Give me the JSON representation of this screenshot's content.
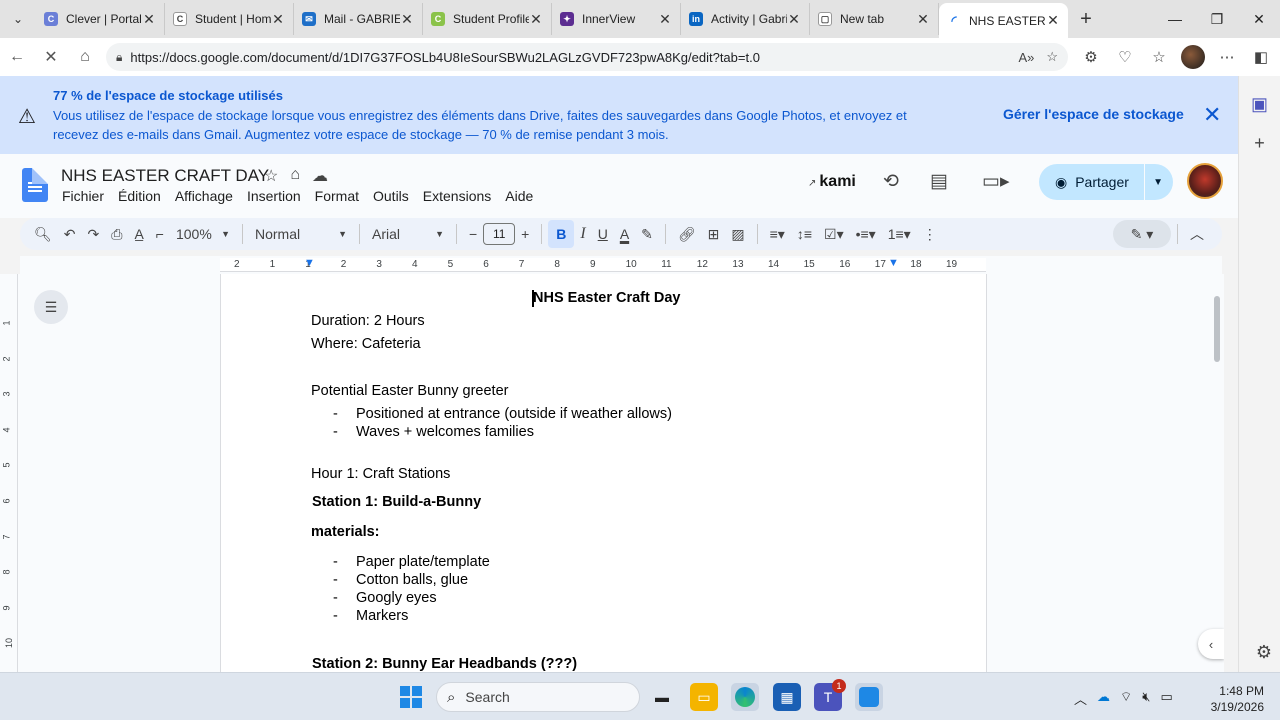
{
  "browser": {
    "tabs": [
      {
        "title": "Clever | Portal",
        "color": "#6b7fd7",
        "glyph": "C"
      },
      {
        "title": "Student | Home",
        "color": "#ffffff",
        "glyph": "C"
      },
      {
        "title": "Mail - GABRIEL",
        "color": "#1e6fc8",
        "glyph": "✉"
      },
      {
        "title": "Student Profile",
        "color": "#8bc34a",
        "glyph": "C"
      },
      {
        "title": "InnerView",
        "color": "#5c2d91",
        "glyph": "✦"
      },
      {
        "title": "Activity | Gabrie",
        "color": "#0a66c2",
        "glyph": "in"
      },
      {
        "title": "New tab",
        "color": "#ffffff",
        "glyph": "▢"
      },
      {
        "title": "NHS EASTER C",
        "color": "#1a73e8",
        "glyph": "◜"
      }
    ],
    "url": "https://docs.google.com/document/d/1DI7G37FOSLb4U8IeSourSBWu2LAGLzGVDF723pwA8Kg/edit?tab=t.0"
  },
  "banner": {
    "title": "77 % de l'espace de stockage utilisés",
    "body": "Vous utilisez de l'espace de stockage lorsque vous enregistrez des éléments dans Drive, faites des sauvegardes dans Google Photos, et envoyez et recevez des e-mails dans Gmail. Augmentez votre espace de stockage — 70 % de remise pendant 3 mois.",
    "action": "Gérer l'espace de stockage"
  },
  "doc": {
    "title": "NHS EASTER CRAFT DAY",
    "menus": [
      "Fichier",
      "Édition",
      "Affichage",
      "Insertion",
      "Format",
      "Outils",
      "Extensions",
      "Aide"
    ],
    "kami": "kami",
    "share_label": "Partager"
  },
  "toolbar": {
    "zoom": "100%",
    "style": "Normal",
    "font": "Arial",
    "font_size": "11"
  },
  "ruler": [
    "2",
    "1",
    "1",
    "2",
    "3",
    "4",
    "5",
    "6",
    "7",
    "8",
    "9",
    "10",
    "11",
    "12",
    "13",
    "14",
    "15",
    "16",
    "17",
    "18",
    "19"
  ],
  "vruler": [
    "1",
    "2",
    "3",
    "4",
    "5",
    "6",
    "7",
    "8",
    "9",
    "10"
  ],
  "content": {
    "heading": "NHS Easter Craft Day",
    "duration": "Duration: 2 Hours",
    "where": "Where: Cafeteria",
    "greeter": "Potential Easter Bunny greeter",
    "greeter_items": [
      "Positioned at entrance (outside if weather allows)",
      "Waves + welcomes families"
    ],
    "hour1": " Hour 1: Craft Stations",
    "station1": "Station 1: Build-a-Bunny",
    "materials": "materials:",
    "material_items": [
      "Paper plate/template",
      "Cotton balls, glue",
      "Googly eyes",
      "Markers"
    ],
    "station2": "Station 2: Bunny Ear Headbands (???)"
  },
  "taskbar": {
    "search_placeholder": "Search",
    "notification_count": "1",
    "time": "1:48 PM",
    "date": "3/19/2026"
  }
}
